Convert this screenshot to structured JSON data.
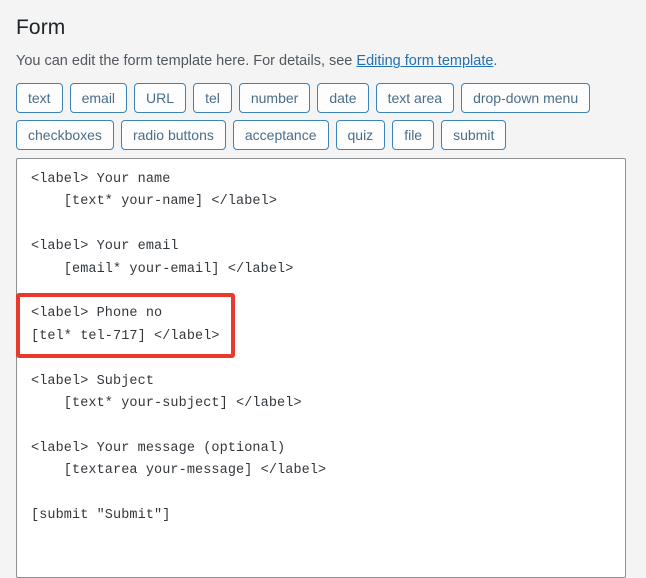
{
  "page": {
    "title": "Form",
    "description_before_link": "You can edit the form template here. For details, see ",
    "description_link": "Editing form template",
    "description_after_link": "."
  },
  "tag_generator": {
    "buttons": [
      {
        "label": "text"
      },
      {
        "label": "email"
      },
      {
        "label": "URL"
      },
      {
        "label": "tel"
      },
      {
        "label": "number"
      },
      {
        "label": "date"
      },
      {
        "label": "text area"
      },
      {
        "label": "drop-down menu"
      },
      {
        "label": "checkboxes"
      },
      {
        "label": "radio buttons"
      },
      {
        "label": "acceptance"
      },
      {
        "label": "quiz"
      },
      {
        "label": "file"
      },
      {
        "label": "submit"
      }
    ]
  },
  "editor": {
    "value": "<label> Your name\n    [text* your-name] </label>\n\n<label> Your email\n    [email* your-email] </label>\n\n<label> Phone no\n[tel* tel-717] </label>\n\n<label> Subject\n    [text* your-subject] </label>\n\n<label> Your message (optional)\n    [textarea your-message] </label>\n\n[submit \"Submit\"]",
    "placeholder": ""
  },
  "annotation": {
    "label": "highlighted-tel-field",
    "color": "#e8392c",
    "highlighted_text": "<label> Phone no\n[tel* tel-717] </label>"
  },
  "colors": {
    "page_background": "#f4f4f4",
    "tag_button_border": "#3c83b8",
    "tag_button_text": "#4a6e8a",
    "link": "#2271b1",
    "heading": "#1d2327",
    "editor_text": "#32373c",
    "editor_border": "#8c8f94",
    "annotation": "#e8392c"
  }
}
